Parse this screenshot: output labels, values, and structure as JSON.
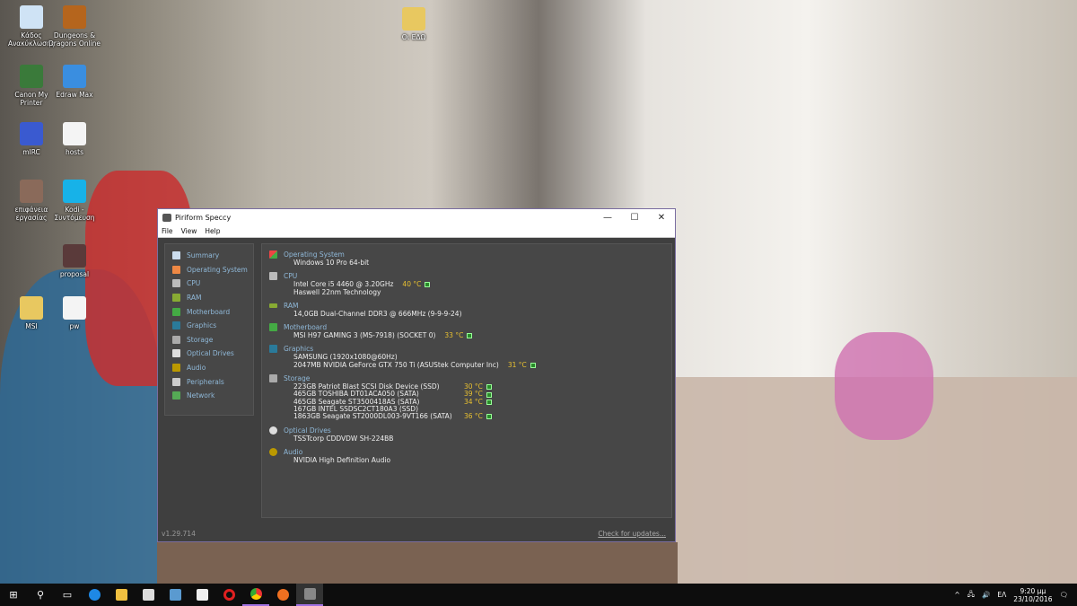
{
  "desktop": {
    "icons": [
      {
        "label": "Κάδος Ανακύκλωσης",
        "color": "#cfe3f5"
      },
      {
        "label": "Dungeons & Dragons Online",
        "color": "#b5651d"
      },
      {
        "label": "Canon My Printer",
        "color": "#3a7a3a"
      },
      {
        "label": "Edraw Max",
        "color": "#3a8ee0"
      },
      {
        "label": "mIRC",
        "color": "#3a5ad0"
      },
      {
        "label": "hosts",
        "color": "#f4f4f4"
      },
      {
        "label": "επιφάνεια εργασίας",
        "color": "#8a6a5a"
      },
      {
        "label": "Kodi - Συντόμευση",
        "color": "#17b2e8"
      },
      {
        "label": "proposal",
        "color": "#5a3a3a"
      },
      {
        "label": "MSI",
        "color": "#e8c860"
      },
      {
        "label": "pw",
        "color": "#f4f4f4"
      },
      {
        "label": "Οι ΕΔΩ",
        "color": "#e8c860"
      }
    ]
  },
  "window": {
    "title": "Piriform Speccy",
    "menu": [
      "File",
      "View",
      "Help"
    ],
    "sidebar": [
      "Summary",
      "Operating System",
      "CPU",
      "RAM",
      "Motherboard",
      "Graphics",
      "Storage",
      "Optical Drives",
      "Audio",
      "Peripherals",
      "Network"
    ],
    "sections": {
      "os": {
        "title": "Operating System",
        "lines": [
          "Windows 10 Pro 64-bit"
        ]
      },
      "cpu": {
        "title": "CPU",
        "lines": [
          "Intel Core i5 4460 @ 3.20GHz",
          "Haswell 22nm Technology"
        ],
        "temp": "40 °C"
      },
      "ram": {
        "title": "RAM",
        "lines": [
          "14,0GB Dual-Channel DDR3 @ 666MHz (9-9-9-24)"
        ]
      },
      "mb": {
        "title": "Motherboard",
        "lines": [
          "MSI H97 GAMING 3 (MS-7918) (SOCKET 0)"
        ],
        "temp": "33 °C"
      },
      "gfx": {
        "title": "Graphics",
        "lines": [
          "SAMSUNG (1920x1080@60Hz)",
          "2047MB NVIDIA GeForce GTX 750 Ti (ASUStek Computer Inc)"
        ],
        "temp": "31 °C"
      },
      "storage": {
        "title": "Storage",
        "drives": [
          {
            "name": "223GB Patriot Blast SCSI Disk Device (SSD)",
            "temp": "30 °C"
          },
          {
            "name": "465GB TOSHIBA DT01ACA050 (SATA)",
            "temp": "39 °C"
          },
          {
            "name": "465GB Seagate ST3500418AS (SATA)",
            "temp": "34 °C"
          },
          {
            "name": "167GB INTEL SSDSC2CT180A3 (SSD)",
            "temp": ""
          },
          {
            "name": "1863GB Seagate ST2000DL003-9VT166 (SATA)",
            "temp": "36 °C"
          }
        ]
      },
      "optical": {
        "title": "Optical Drives",
        "lines": [
          "TSSTcorp CDDVDW SH-224BB"
        ]
      },
      "audio": {
        "title": "Audio",
        "lines": [
          "NVIDIA High Definition Audio"
        ]
      }
    },
    "version": "v1.29.714",
    "update_link": "Check for updates..."
  },
  "taskbar": {
    "lang": "ΕΛ",
    "time": "9:20 μμ",
    "date": "23/10/2016"
  }
}
